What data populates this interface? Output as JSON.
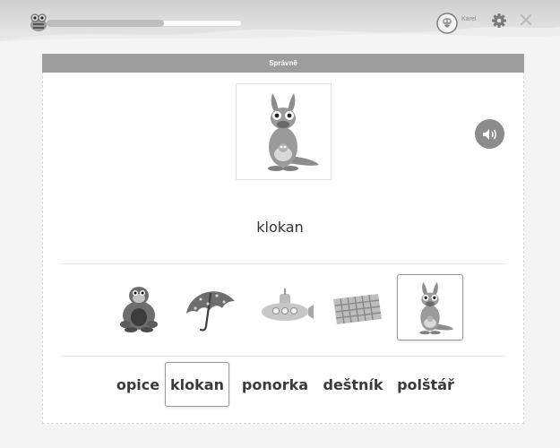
{
  "header": {
    "user_name": "Karel",
    "progress": 0.6,
    "icons": [
      "bee-icon",
      "avatar-icon",
      "gear-icon",
      "close-icon"
    ]
  },
  "status": {
    "text": "Správně"
  },
  "question": {
    "word": "klokan",
    "picture": "kangaroo",
    "sound_icon": "speaker-icon"
  },
  "picture_options": [
    {
      "name": "gorilla",
      "selected": false
    },
    {
      "name": "umbrella",
      "selected": false
    },
    {
      "name": "submarine",
      "selected": false
    },
    {
      "name": "mat",
      "selected": false
    },
    {
      "name": "kangaroo",
      "selected": true
    }
  ],
  "word_options": [
    {
      "label": "opice",
      "selected": false
    },
    {
      "label": "klokan",
      "selected": true
    },
    {
      "label": "ponorka",
      "selected": false
    },
    {
      "label": "deštník",
      "selected": false
    },
    {
      "label": "polštář",
      "selected": false
    }
  ],
  "colors": {
    "status_bar": "#9d9d9d",
    "selection_border": "#9a9a9a"
  }
}
